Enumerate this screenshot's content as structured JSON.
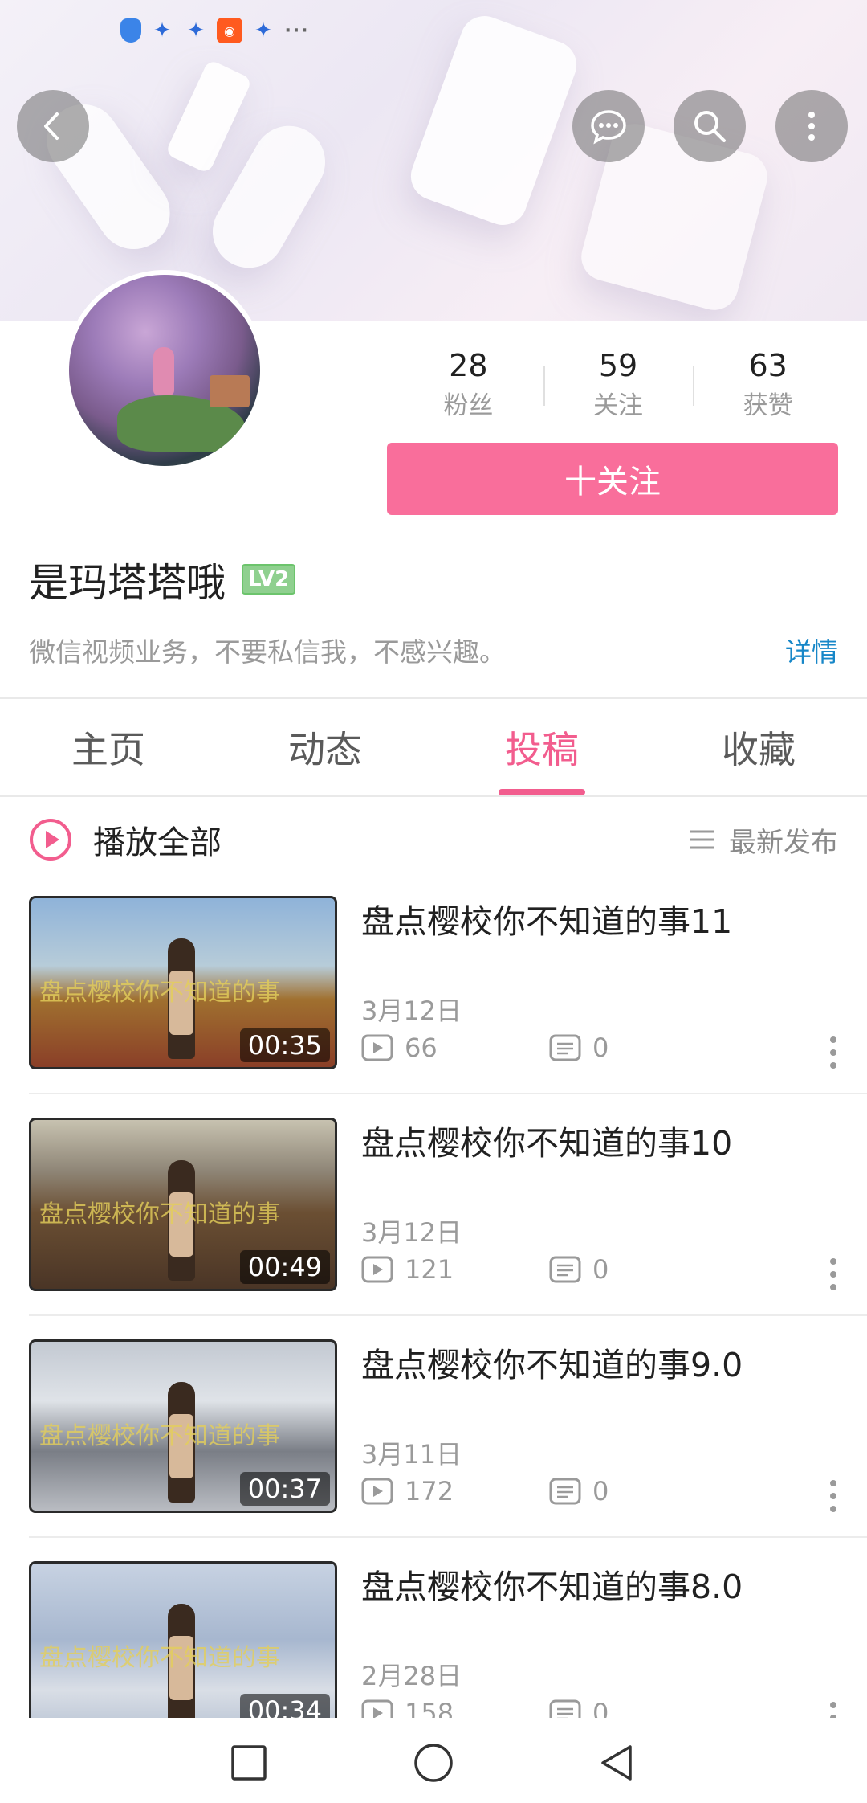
{
  "profile": {
    "name": "是玛塔塔哦",
    "level": "LV2",
    "bio": "微信视频业务，不要私信我，不感兴趣。",
    "detail_label": "详情",
    "follow_label": "十关注",
    "stats": [
      {
        "value": "28",
        "label": "粉丝"
      },
      {
        "value": "59",
        "label": "关注"
      },
      {
        "value": "63",
        "label": "获赞"
      }
    ]
  },
  "tabs": [
    {
      "label": "主页",
      "active": false
    },
    {
      "label": "动态",
      "active": false
    },
    {
      "label": "投稿",
      "active": true
    },
    {
      "label": "收藏",
      "active": false
    }
  ],
  "playall": {
    "label": "播放全部",
    "sort_label": "最新发布"
  },
  "videos": [
    {
      "title": "盘点樱校你不知道的事11",
      "date": "3月12日",
      "plays": "66",
      "comments": "0",
      "duration": "00:35"
    },
    {
      "title": "盘点樱校你不知道的事10",
      "date": "3月12日",
      "plays": "121",
      "comments": "0",
      "duration": "00:49"
    },
    {
      "title": "盘点樱校你不知道的事9.0",
      "date": "3月11日",
      "plays": "172",
      "comments": "0",
      "duration": "00:37"
    },
    {
      "title": "盘点樱校你不知道的事8.0",
      "date": "2月28日",
      "plays": "158",
      "comments": "0",
      "duration": "00:34"
    }
  ],
  "thumb_overlays": [
    "盘点樱校你不知道的事",
    "盘点樱校你不知道的事",
    "盘点樱校你不知道的事",
    "盘点樱校你不知道的事"
  ],
  "colors": {
    "accent": "#f25d8e",
    "follow": "#f96e9b",
    "link": "#1787c8",
    "muted": "#9a9a9a"
  },
  "icons": {
    "back": "back-arrow-icon",
    "message": "message-bubble-icon",
    "search": "search-icon",
    "more": "more-vertical-icon",
    "play": "play-circle-icon",
    "sort": "list-icon",
    "plays": "play-count-icon",
    "comments": "comment-icon",
    "nav_recent": "square-icon",
    "nav_home": "circle-icon",
    "nav_back": "triangle-back-icon"
  }
}
